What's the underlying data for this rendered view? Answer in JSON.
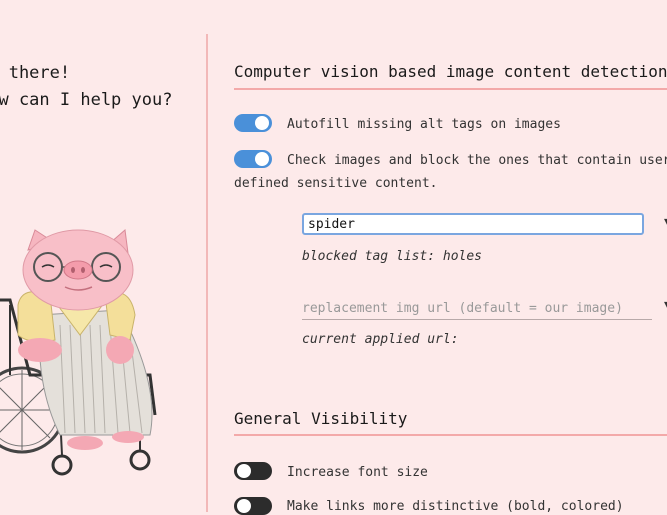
{
  "greeting": {
    "line1": "Hi there!",
    "line2": "How can I help you?"
  },
  "vision_section": {
    "title": "Computer vision based image content detection",
    "options": [
      {
        "label": "Autofill missing alt tags on images",
        "enabled": true
      },
      {
        "label_line1": "Check images and block the ones that contain user",
        "label_line2": "defined sensitive content.",
        "enabled": true
      }
    ],
    "tag_input": {
      "value": "spider"
    },
    "blocked_tags": "blocked tag list: holes",
    "url_input": {
      "value": "",
      "placeholder": "replacement img url (default = our image)"
    },
    "current_url": "current applied url:"
  },
  "visibility_section": {
    "title": "General Visibility",
    "options": [
      {
        "label": "Increase font size",
        "enabled": false
      },
      {
        "label": "Make links more distinctive (bold, colored)",
        "enabled": false
      }
    ]
  },
  "colors": {
    "background": "#fdeaea",
    "accent": "#4a90d9",
    "rule": "#f3a9a9"
  }
}
